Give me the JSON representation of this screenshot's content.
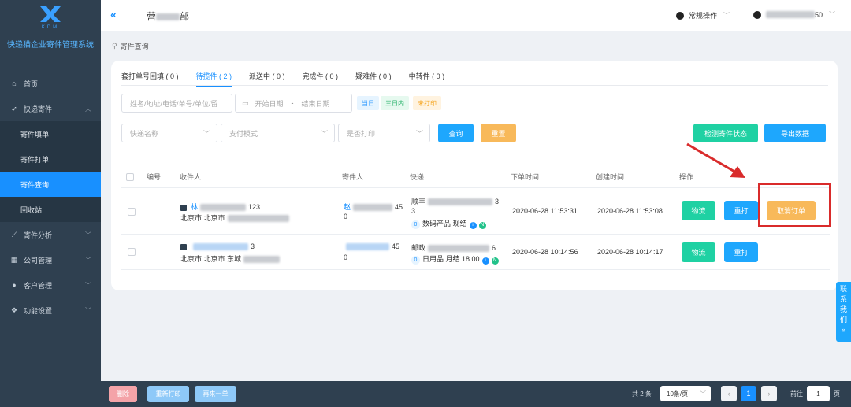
{
  "sidebar": {
    "logo_text": "KDM",
    "system_name": "快递猫企业寄件管理系统",
    "items": [
      {
        "label": "首页",
        "icon": "home-icon",
        "glyph": "⌂"
      },
      {
        "label": "快递寄件",
        "icon": "send-icon",
        "glyph": "➶"
      },
      {
        "label": "寄件填单"
      },
      {
        "label": "寄件打单"
      },
      {
        "label": "寄件查询"
      },
      {
        "label": "回收站"
      },
      {
        "label": "寄件分析",
        "icon": "chart-icon",
        "glyph": "⟋"
      },
      {
        "label": "公司管理",
        "icon": "company-icon",
        "glyph": "▦"
      },
      {
        "label": "客户管理",
        "icon": "user-icon",
        "glyph": "●"
      },
      {
        "label": "功能设置",
        "icon": "settings-icon",
        "glyph": "❖"
      }
    ]
  },
  "header": {
    "collapse_glyph": "«",
    "dept_prefix": "营",
    "dept_suffix": "部",
    "operation": "常规操作",
    "user_suffix": "50"
  },
  "breadcrumb": {
    "label": "寄件查询"
  },
  "tabs": [
    {
      "label": "套打单号回填 ( 0 )"
    },
    {
      "label": "待揽件 ( 2 )"
    },
    {
      "label": "派送中 ( 0 )"
    },
    {
      "label": "完成件 ( 0 )"
    },
    {
      "label": "疑难件 ( 0 )"
    },
    {
      "label": "中转件 ( 0 )"
    }
  ],
  "filters": {
    "search_placeholder": "姓名/地址/电话/单号/单位/留",
    "start_date": "开始日期",
    "date_sep": "-",
    "end_date": "结束日期",
    "today": "当日",
    "three_days": "三日内",
    "not_printed": "未打印",
    "courier": "快递名称",
    "payment": "支付模式",
    "printed": "是否打印",
    "query": "查询",
    "reset": "重置",
    "check_status": "检测寄件状态",
    "export": "导出数据"
  },
  "table": {
    "headers": [
      "编号",
      "收件人",
      "寄件人",
      "快递",
      "下单时间",
      "创建时间",
      "操作"
    ],
    "rows": [
      {
        "recipient_name": "林",
        "recipient_phone_tail": "123",
        "recipient_addr": "北京市 北京市",
        "sender_name": "赵",
        "sender_phone_tail": "45",
        "sender_line2": "0",
        "courier": "顺丰",
        "courier_tail": "3",
        "tracking_line2": "3",
        "badge": "0",
        "product": "数码产品 现结",
        "order_time": "2020-06-28 11:53:31",
        "create_time": "2020-06-28 11:53:08",
        "btn_logistics": "物流",
        "btn_reprint": "重打",
        "btn_cancel": "取消订单"
      },
      {
        "recipient_name": "",
        "recipient_phone_tail": "3",
        "recipient_addr": "北京市 北京市 东城",
        "sender_name": "",
        "sender_phone_tail": "45",
        "sender_line2": "0",
        "courier": "邮政",
        "courier_tail": "6",
        "badge": "0",
        "product": "日用品 月结 18.00",
        "order_time": "2020-06-28 10:14:56",
        "create_time": "2020-06-28 10:14:17",
        "btn_logistics": "物流",
        "btn_reprint": "重打"
      }
    ]
  },
  "contact": {
    "label": "联系我们",
    "glyph": "«"
  },
  "footer": {
    "delete": "删除",
    "reprint": "重新打印",
    "again": "再来一单",
    "total": "共 2 条",
    "page_size": "10条/页",
    "current_page": "1",
    "goto_label": "前往",
    "goto_value": "1",
    "page_unit": "页"
  },
  "colors": {
    "sidebar_bg": "#2f4050",
    "accent": "#1890ff",
    "active_nav": "#1890ff",
    "green": "#1fd1a3",
    "orange": "#f8b95a",
    "annotation_red": "#d92b2b"
  }
}
